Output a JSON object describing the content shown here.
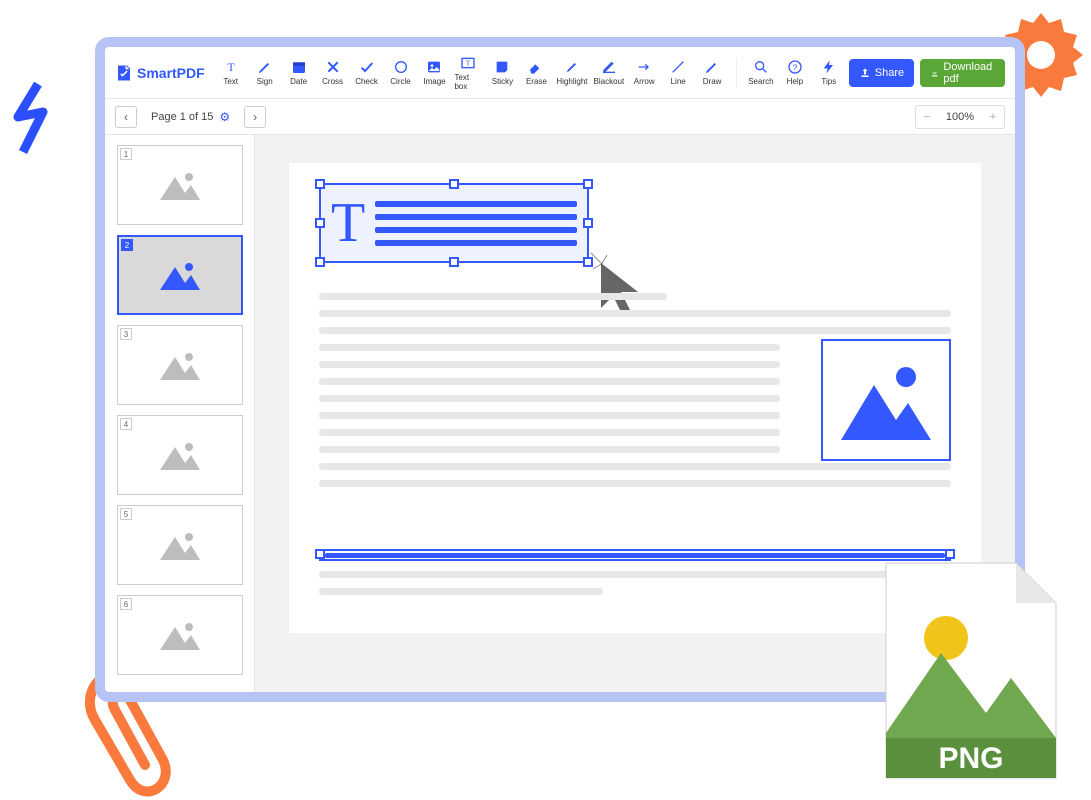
{
  "brand": "SmartPDF",
  "tools": [
    {
      "label": "Text"
    },
    {
      "label": "Sign"
    },
    {
      "label": "Date"
    },
    {
      "label": "Cross"
    },
    {
      "label": "Check"
    },
    {
      "label": "Circle"
    },
    {
      "label": "Image"
    },
    {
      "label": "Text box"
    },
    {
      "label": "Sticky"
    },
    {
      "label": "Erase"
    },
    {
      "label": "Highlight"
    },
    {
      "label": "Blackout"
    },
    {
      "label": "Arrow"
    },
    {
      "label": "Line"
    },
    {
      "label": "Draw"
    }
  ],
  "right_tools": [
    {
      "label": "Search"
    },
    {
      "label": "Help"
    },
    {
      "label": "Tips"
    }
  ],
  "buttons": {
    "share": "Share",
    "download": "Download pdf"
  },
  "page_label": "Page 1 of 15",
  "zoom": "100%",
  "thumbs": [
    1,
    2,
    3,
    4,
    5,
    6
  ],
  "selected_thumb": 2,
  "png_badge": "PNG"
}
